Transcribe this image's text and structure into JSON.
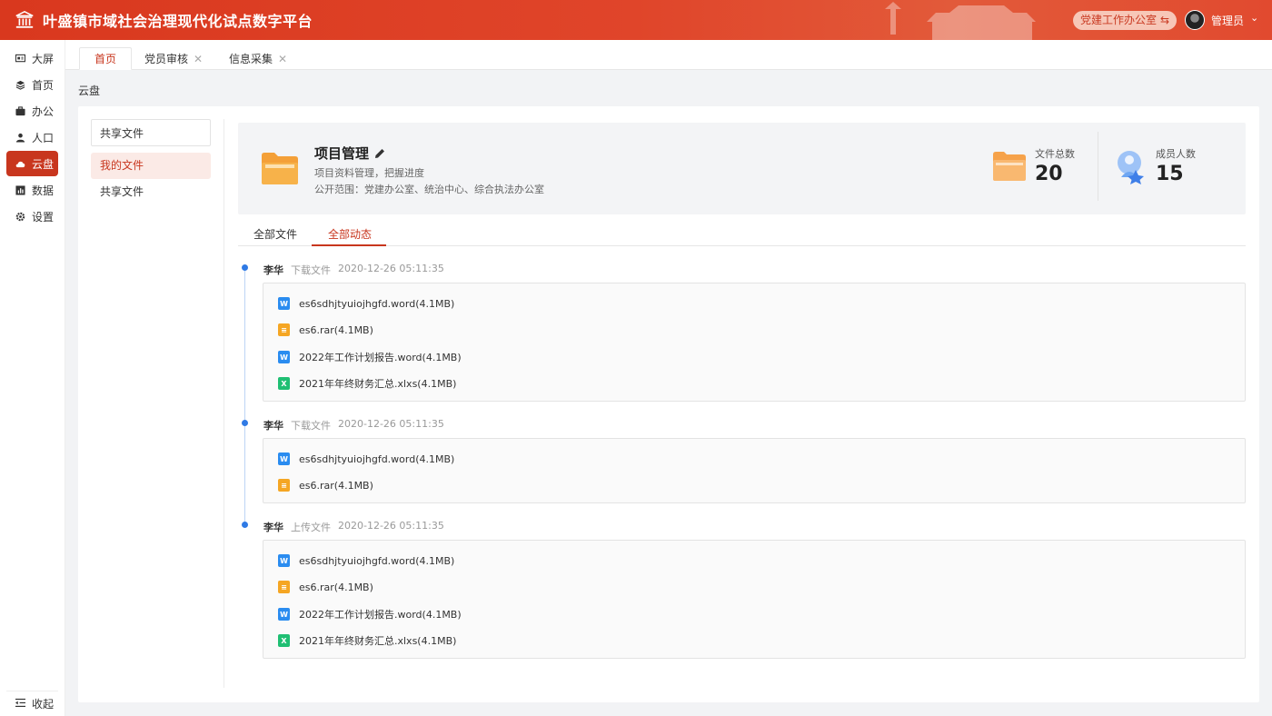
{
  "header": {
    "title": "叶盛镇市域社会治理现代化试点数字平台",
    "office": "党建工作办公室",
    "user": "管理员"
  },
  "sidebar": {
    "items": [
      {
        "label": "大屏",
        "icon": "screen-icon"
      },
      {
        "label": "首页",
        "icon": "layers-icon"
      },
      {
        "label": "办公",
        "icon": "briefcase-icon"
      },
      {
        "label": "人口",
        "icon": "person-icon"
      },
      {
        "label": "云盘",
        "icon": "cloud-icon"
      },
      {
        "label": "数据",
        "icon": "chart-icon"
      },
      {
        "label": "设置",
        "icon": "gear-icon"
      }
    ],
    "collapse": "收起"
  },
  "tabs": [
    {
      "label": "首页"
    },
    {
      "label": "党员审核"
    },
    {
      "label": "信息采集"
    }
  ],
  "breadcrumb": "云盘",
  "left_panel": {
    "search_value": "共享文件",
    "items": [
      {
        "label": "我的文件"
      },
      {
        "label": "共享文件"
      }
    ]
  },
  "project": {
    "name": "项目管理",
    "desc": "项目资料管理，把握进度",
    "scope": "公开范围：党建办公室、统治中心、综合执法办公室",
    "file_total_label": "文件总数",
    "file_total": "20",
    "members_label": "成员人数",
    "members": "15"
  },
  "content_tabs": [
    {
      "label": "全部文件"
    },
    {
      "label": "全部动态"
    }
  ],
  "timeline": [
    {
      "who": "李华",
      "action": "下载文件",
      "time": "2020-12-26 05:11:35",
      "files": [
        {
          "type": "word",
          "name": "es6sdhjtyuiojhgfd.word(4.1MB)"
        },
        {
          "type": "rar",
          "name": "es6.rar(4.1MB)"
        },
        {
          "type": "word",
          "name": "2022年工作计划报告.word(4.1MB)"
        },
        {
          "type": "xls",
          "name": "2021年年终财务汇总.xlxs(4.1MB)"
        }
      ]
    },
    {
      "who": "李华",
      "action": "下载文件",
      "time": "2020-12-26 05:11:35",
      "files": [
        {
          "type": "word",
          "name": "es6sdhjtyuiojhgfd.word(4.1MB)"
        },
        {
          "type": "rar",
          "name": "es6.rar(4.1MB)"
        }
      ]
    },
    {
      "who": "李华",
      "action": "上传文件",
      "time": "2020-12-26 05:11:35",
      "files": [
        {
          "type": "word",
          "name": "es6sdhjtyuiojhgfd.word(4.1MB)"
        },
        {
          "type": "rar",
          "name": "es6.rar(4.1MB)"
        },
        {
          "type": "word",
          "name": "2022年工作计划报告.word(4.1MB)"
        },
        {
          "type": "xls",
          "name": "2021年年终财务汇总.xlxs(4.1MB)"
        }
      ]
    }
  ],
  "colors": {
    "accent": "#c8361e",
    "timeline_dot": "#2f7ae5",
    "word": "#2a8cf0",
    "rar": "#f5a623",
    "xls": "#1fbf73"
  }
}
